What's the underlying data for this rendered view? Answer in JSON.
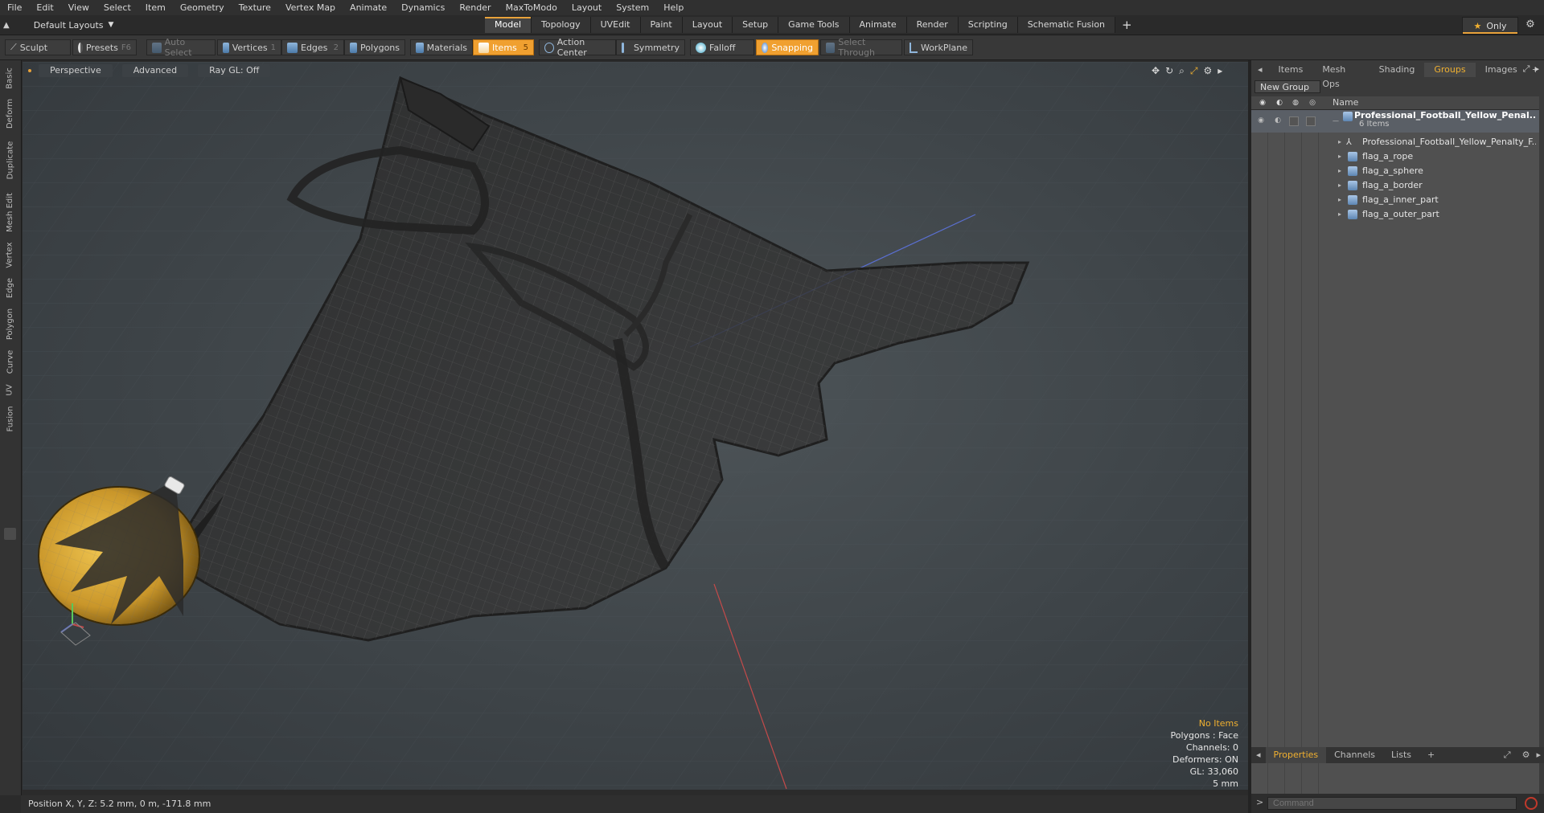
{
  "menu": [
    "File",
    "Edit",
    "View",
    "Select",
    "Item",
    "Geometry",
    "Texture",
    "Vertex Map",
    "Animate",
    "Dynamics",
    "Render",
    "MaxToModo",
    "Layout",
    "System",
    "Help"
  ],
  "layout_selector": "Default Layouts",
  "mode_tabs": [
    "Model",
    "Topology",
    "UVEdit",
    "Paint",
    "Layout",
    "Setup",
    "Game Tools",
    "Animate",
    "Render",
    "Scripting",
    "Schematic Fusion"
  ],
  "active_mode_tab": "Model",
  "only_label": "Only",
  "toolbar": {
    "sculpt": "Sculpt",
    "presets": "Presets",
    "presets_key": "F6",
    "auto_select": "Auto Select",
    "vertices": "Vertices",
    "vertices_key": "1",
    "edges": "Edges",
    "edges_key": "2",
    "polygons": "Polygons",
    "materials": "Materials",
    "items": "Items",
    "items_key": "5",
    "action_center": "Action Center",
    "symmetry": "Symmetry",
    "falloff": "Falloff",
    "snapping": "Snapping",
    "select_through": "Select Through",
    "workplane": "WorkPlane"
  },
  "side_tabs": [
    "Basic",
    "Deform",
    "Duplicate",
    "Mesh Edit",
    "Vertex",
    "Edge",
    "Polygon",
    "Curve",
    "UV",
    "Fusion"
  ],
  "viewport": {
    "view": "Perspective",
    "shading": "Advanced",
    "raygl": "Ray GL: Off",
    "stats": {
      "no_items": "No Items",
      "polygons": "Polygons : Face",
      "channels": "Channels: 0",
      "deformers": "Deformers: ON",
      "gl": "GL: 33,060",
      "scale": "5 mm"
    }
  },
  "status": "Position X, Y, Z:   5.2 mm, 0 m, -171.8 mm",
  "right_panel": {
    "tabs": [
      "Items",
      "Mesh Ops",
      "Shading",
      "Groups",
      "Images"
    ],
    "active_tab": "Groups",
    "new_group": "New Group",
    "name_header": "Name",
    "root": {
      "label": "Professional_Football_Yellow_Penal...",
      "count": "6 Items"
    },
    "items": [
      "Professional_Football_Yellow_Penalty_F...",
      "flag_a_rope",
      "flag_a_sphere",
      "flag_a_border",
      "flag_a_inner_part",
      "flag_a_outer_part"
    ],
    "bottom_tabs": [
      "Properties",
      "Channels",
      "Lists"
    ],
    "active_bottom_tab": "Properties",
    "command_placeholder": "Command"
  }
}
